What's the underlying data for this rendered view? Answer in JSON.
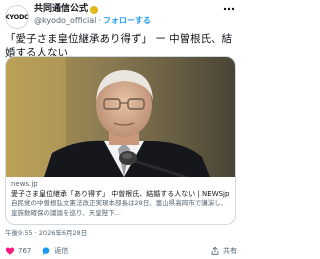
{
  "author": {
    "avatar_text": "KYODO",
    "name": "共同通信公式",
    "handle": "@kyodo_official",
    "separator": "·",
    "follow_label": "フォローする"
  },
  "tweet": {
    "text": "「愛子さま皇位継承あり得ず」 ー 中曽根氏、結婚する人ない"
  },
  "card": {
    "domain": "news.jp",
    "title": "愛子さま皇位継承「あり得ず」 中曽根氏、結婚する人ない | NEWSjp",
    "description": "自民党の中曽根弘文憲法改正実現本部長は28日、富山県高岡市で講演し、皇族数確保の議論を巡り、天皇陛下..."
  },
  "timestamp": "午後9:55 · 2026年6月28日",
  "actions": {
    "likes": "767",
    "reply_label": "返信",
    "share_label": "共有"
  },
  "colors": {
    "accent": "#1d9bf0",
    "like": "#f91880",
    "badge": "#e2b719"
  },
  "icons": [
    "more-icon",
    "verified-badge-icon",
    "heart-icon",
    "reply-icon",
    "share-icon"
  ]
}
